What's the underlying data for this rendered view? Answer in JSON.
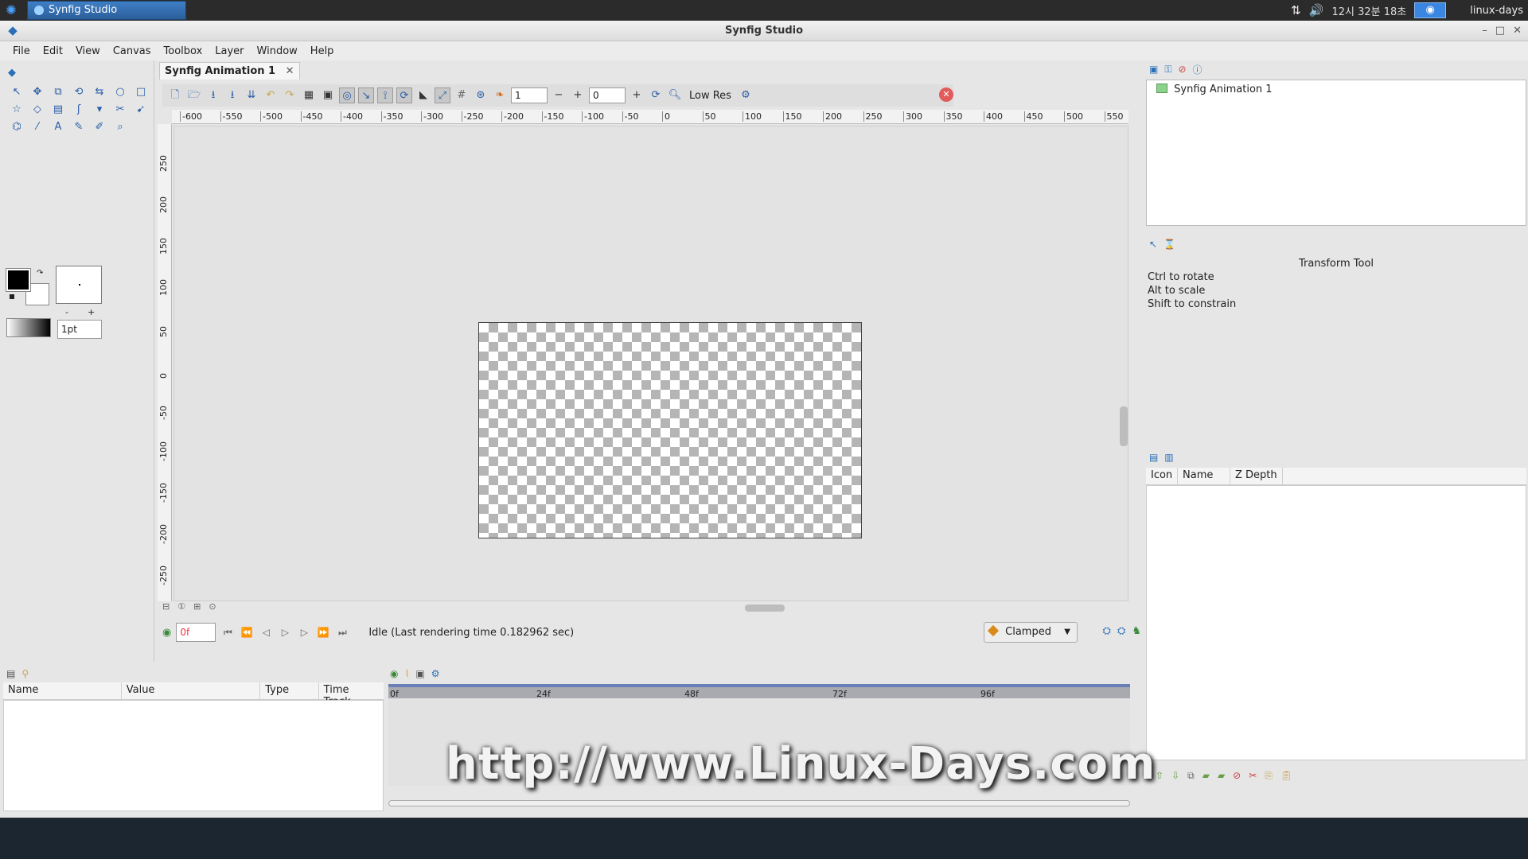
{
  "taskbar": {
    "window_title": "Synfig Studio",
    "clock": "12시 32분 18초",
    "user": "linux-days"
  },
  "window": {
    "title": "Synfig Studio",
    "minimize": "–",
    "maximize": "□",
    "close": "✕"
  },
  "menu": [
    "File",
    "Edit",
    "View",
    "Canvas",
    "Toolbox",
    "Layer",
    "Window",
    "Help"
  ],
  "canvas": {
    "tab_title": "Synfig Animation 1",
    "tab_close": "✕",
    "spin_a": "1",
    "spin_b": "0",
    "lowres_label": "Low Res",
    "hruler_ticks": [
      "-600",
      "-550",
      "-500",
      "-450",
      "-400",
      "-350",
      "-300",
      "-250",
      "-200",
      "-150",
      "-100",
      "-50",
      "0",
      "50",
      "100",
      "150",
      "200",
      "250",
      "300",
      "350",
      "400",
      "450",
      "500",
      "550"
    ],
    "vruler_ticks": [
      "250",
      "200",
      "150",
      "100",
      "50",
      "0",
      "-50",
      "-100",
      "-150",
      "-200",
      "-250"
    ],
    "frame": "0f",
    "status": "Idle (Last rendering time 0.182962 sec)",
    "interpolation": "Clamped"
  },
  "toolbox": {
    "width_value": "1pt",
    "minus": "-",
    "plus": "+"
  },
  "canvas_browser": {
    "item": "Synfig Animation 1"
  },
  "tool_options": {
    "title": "Transform Tool",
    "lines": [
      "Ctrl to rotate",
      "Alt to scale",
      "Shift to constrain"
    ]
  },
  "layers": {
    "columns": [
      "Icon",
      "Name",
      "Z Depth"
    ]
  },
  "params": {
    "columns": [
      "Name",
      "Value",
      "Type",
      "Time Track"
    ]
  },
  "timetrack": {
    "marks": [
      "0f",
      "24f",
      "48f",
      "72f",
      "96f"
    ]
  },
  "watermark": "http://www.Linux-Days.com"
}
